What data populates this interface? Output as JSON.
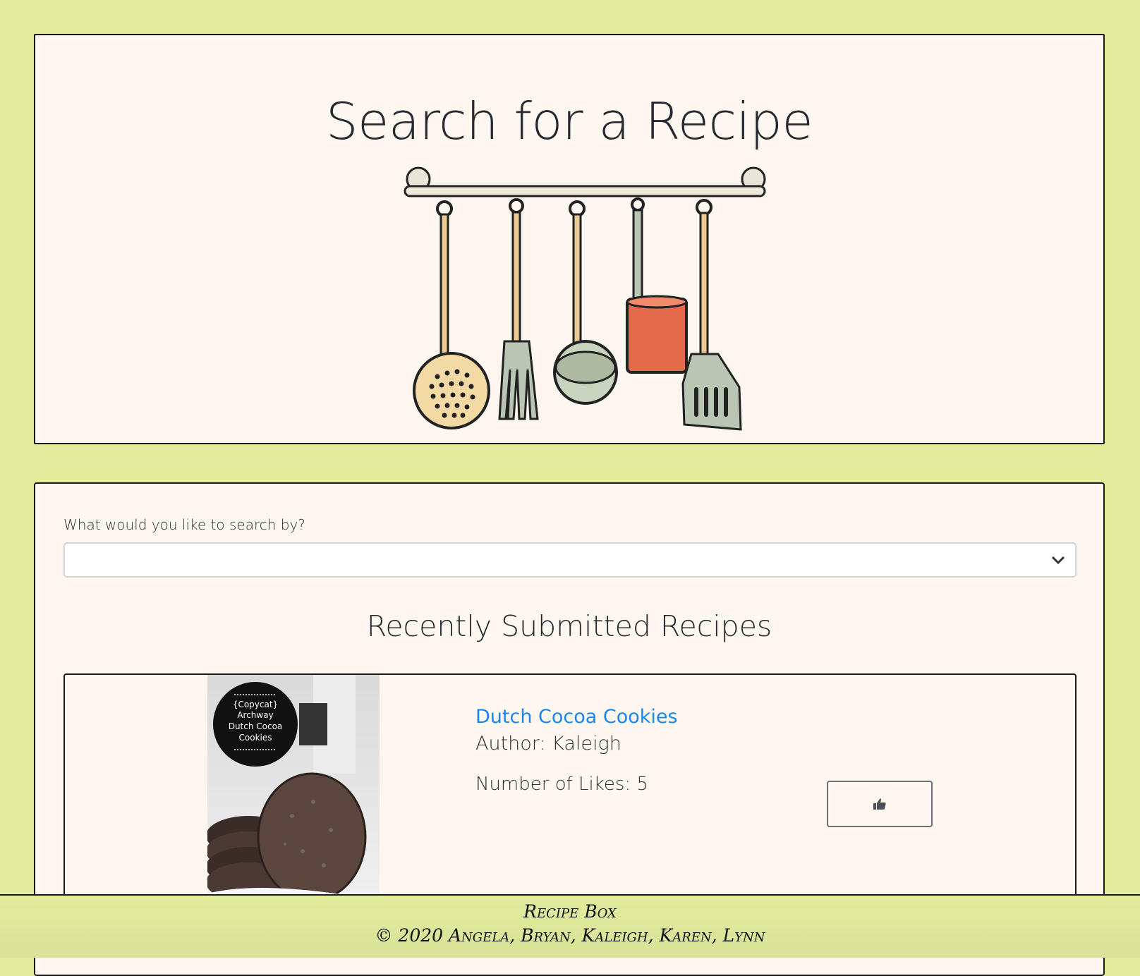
{
  "hero": {
    "title": "Search for a Recipe"
  },
  "search": {
    "label": "What would you like to search by?",
    "selected": ""
  },
  "recent": {
    "heading": "Recently Submitted Recipes"
  },
  "recipe": {
    "image_text": [
      "{Copycat}",
      "Archway",
      "Dutch Cocoa",
      "Cookies"
    ],
    "title": "Dutch Cocoa Cookies",
    "author": "Author: Kaleigh",
    "likes": "Number of Likes: 5"
  },
  "footer": {
    "brand": "Recipe Box",
    "copyright": "© 2020 Angela, Bryan, Kaleigh, Karen, Lynn"
  }
}
